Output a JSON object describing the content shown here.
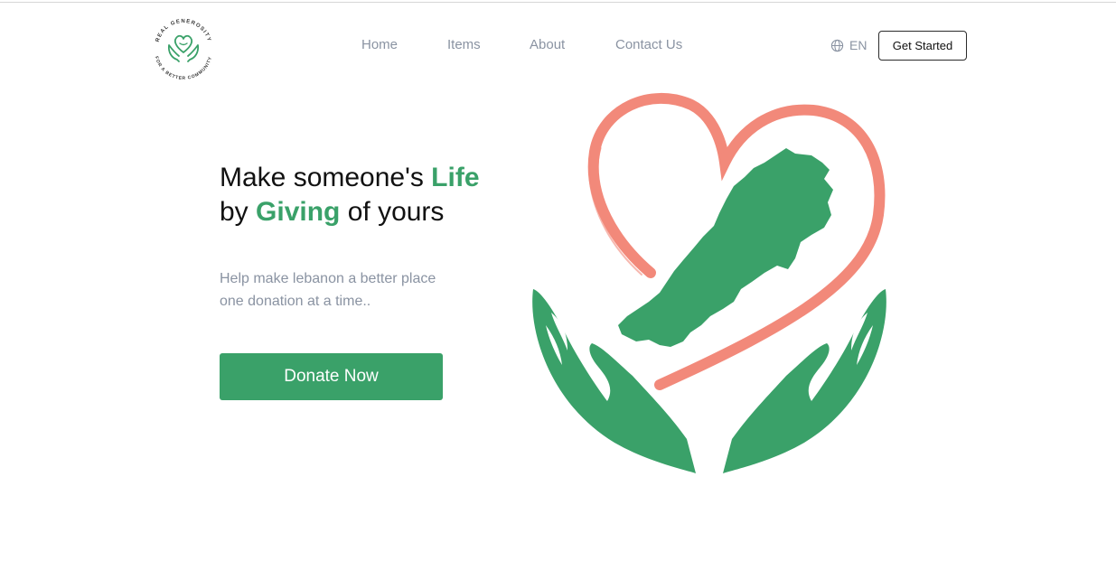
{
  "logo": {
    "icon": "heart-hands-logo-icon",
    "ring_text_top": "REAL GENEROSITY",
    "ring_text_bottom": "FOR A BETTER COMMUNITY"
  },
  "nav": {
    "items": [
      {
        "label": "Home"
      },
      {
        "label": "Items"
      },
      {
        "label": "About"
      },
      {
        "label": "Contact Us"
      }
    ]
  },
  "language": {
    "icon": "globe-icon",
    "label": "EN"
  },
  "header": {
    "cta_label": "Get Started"
  },
  "hero": {
    "title_part1": "Make someone's ",
    "title_accent1": "Life",
    "title_part2": "by ",
    "title_accent2": "Giving",
    "title_part3": " of yours",
    "subtitle_line1": "Help make lebanon a better place",
    "subtitle_line2": "one donation at a time..",
    "donate_label": "Donate Now",
    "illustration_icon": "heart-lebanon-hands-illustration"
  },
  "colors": {
    "brand_green": "#3aa169",
    "heart_coral": "#f2897a",
    "muted_text": "#8a93a2",
    "heading_text": "#111111"
  }
}
